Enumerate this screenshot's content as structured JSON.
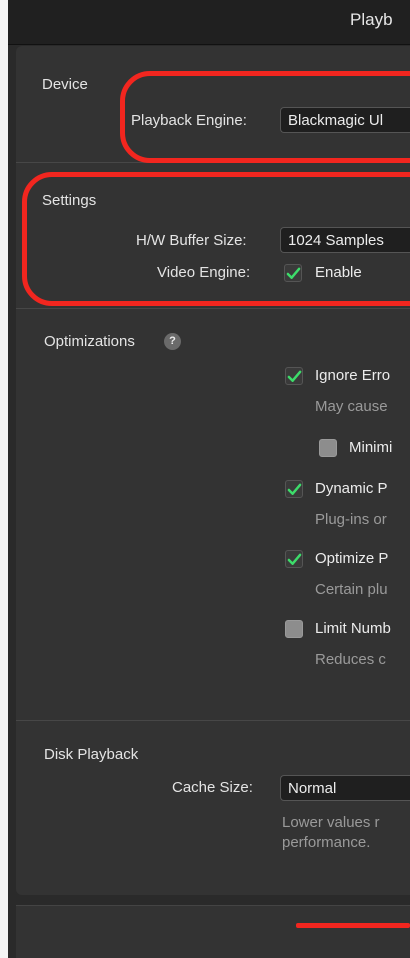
{
  "window": {
    "title": "Playb"
  },
  "device": {
    "title": "Device",
    "playback_engine_label": "Playback Engine:",
    "playback_engine_value": "Blackmagic Ul"
  },
  "settings": {
    "title": "Settings",
    "buffer_label": "H/W Buffer Size:",
    "buffer_value": "1024 Samples",
    "video_engine_label": "Video Engine:",
    "video_engine_option": "Enable",
    "video_engine_checked": true
  },
  "optimizations": {
    "title": "Optimizations",
    "help": "?",
    "items": [
      {
        "label": "Ignore Erro",
        "desc": "May cause",
        "checked": true
      },
      {
        "label": "Minimi",
        "checked": false
      },
      {
        "label": "Dynamic P",
        "desc": "Plug-ins or",
        "checked": true
      },
      {
        "label": "Optimize P",
        "desc": "Certain plu",
        "checked": true
      },
      {
        "label": "Limit Numb",
        "desc": "Reduces c",
        "checked": false
      }
    ]
  },
  "disk_playback": {
    "title": "Disk Playback",
    "cache_label": "Cache Size:",
    "cache_value": "Normal",
    "desc_line1": "Lower values r",
    "desc_line2": "performance."
  },
  "colors": {
    "highlight": "#f2261f",
    "check": "#3ddc6a",
    "panel": "#333333"
  }
}
